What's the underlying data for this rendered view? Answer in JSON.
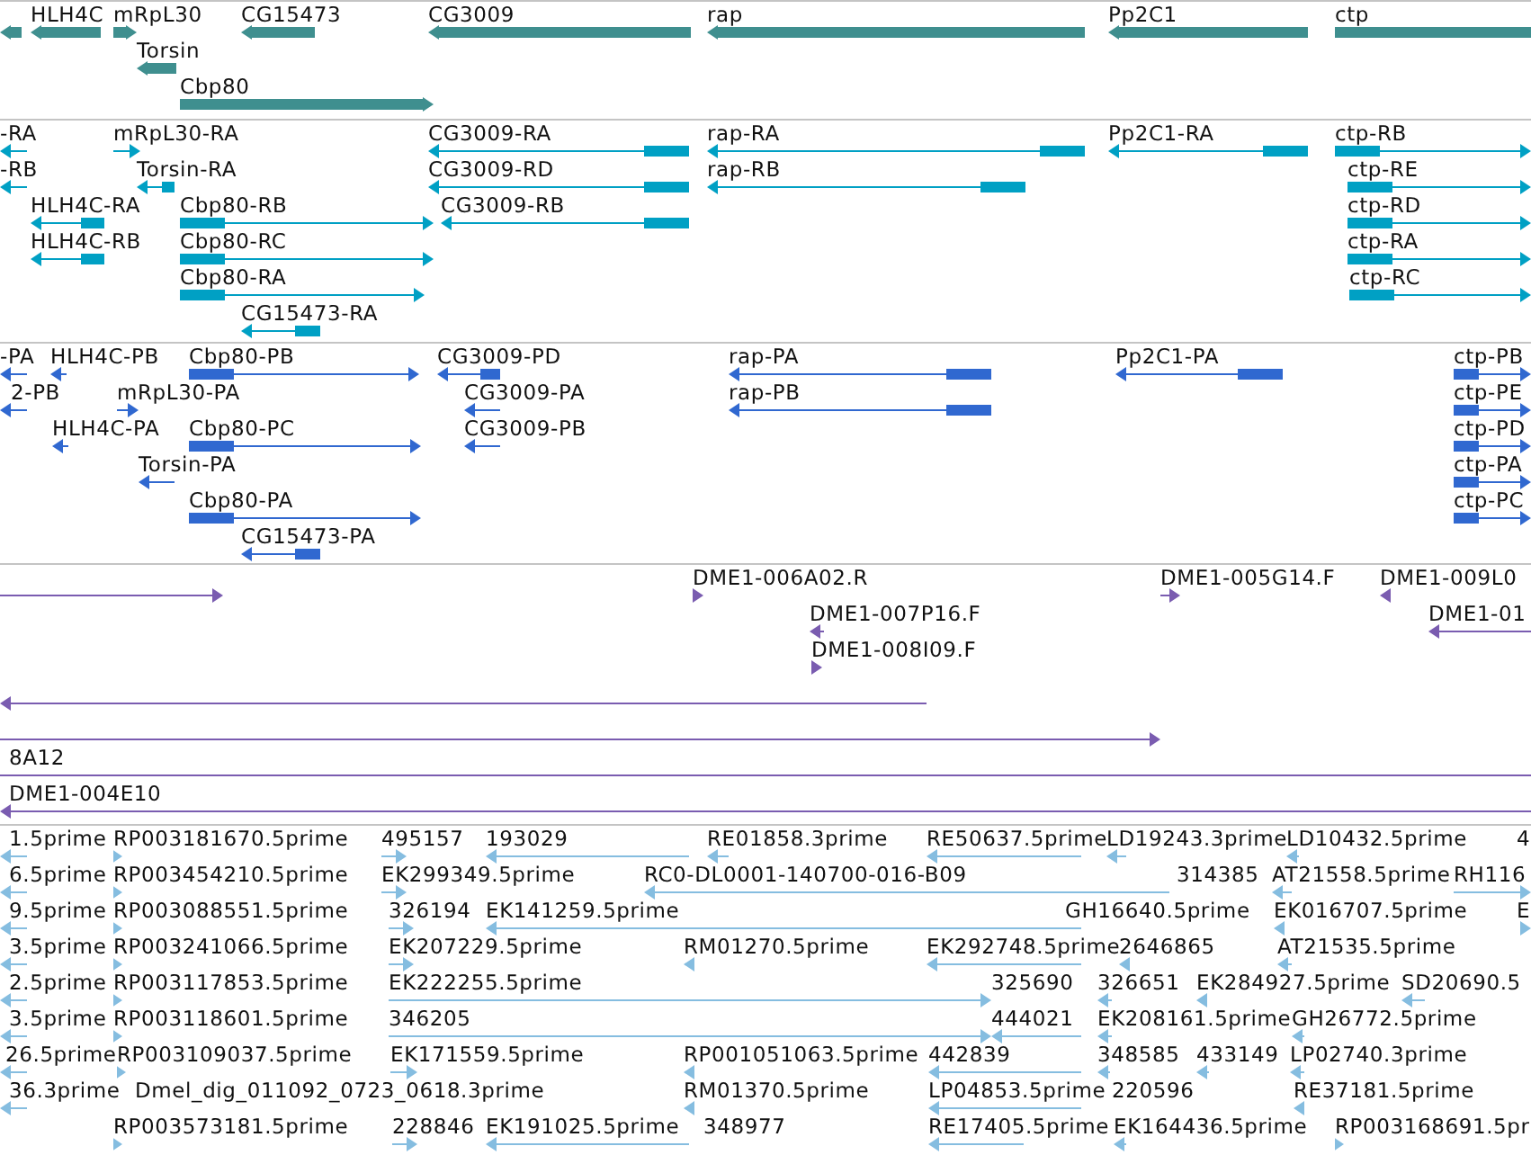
{
  "tracks": [
    {
      "kind": "gene",
      "color": "#3f8f8f",
      "rows": [
        {
          "features": [
            {
              "kind": "reverse"
            },
            {
              "label": "HLH4C",
              "kind": "reverse"
            },
            {
              "label": "mRpL30",
              "kind": "forward"
            },
            {
              "label": "CG15473",
              "kind": "reverse"
            },
            {
              "label": "CG3009",
              "kind": "reverse"
            },
            {
              "label": "rap",
              "kind": "reverse"
            },
            {
              "label": "Pp2C1",
              "kind": "reverse"
            },
            {
              "label": "ctp",
              "kind": "plain"
            }
          ]
        },
        {
          "features": [
            {
              "label": "Torsin",
              "kind": "reverse"
            }
          ]
        },
        {
          "features": [
            {
              "label": "Cbp80",
              "kind": "forward"
            }
          ]
        }
      ]
    },
    {
      "kind": "transcript",
      "color": "#00a0c4",
      "rows": [
        {
          "features": [
            {
              "label": "-RA",
              "kind": "reverse"
            },
            {
              "label": "mRpL30-RA",
              "kind": "forward"
            },
            {
              "label": "CG3009-RA",
              "kind": "reverse"
            },
            {
              "label": "rap-RA",
              "kind": "reverse"
            },
            {
              "label": "Pp2C1-RA",
              "kind": "reverse"
            },
            {
              "label": "ctp-RB",
              "kind": "forward"
            }
          ]
        },
        {
          "features": [
            {
              "label": "-RB",
              "kind": "reverse"
            },
            {
              "label": "Torsin-RA",
              "kind": "reverse"
            },
            {
              "label": "CG3009-RD",
              "kind": "reverse"
            },
            {
              "label": "rap-RB",
              "kind": "reverse"
            },
            {
              "label": "ctp-RE",
              "kind": "forward"
            }
          ]
        },
        {
          "features": [
            {
              "label": "HLH4C-RA",
              "kind": "reverse"
            },
            {
              "label": "Cbp80-RB",
              "kind": "forward"
            },
            {
              "label": "CG3009-RB",
              "kind": "reverse"
            },
            {
              "label": "ctp-RD",
              "kind": "forward"
            }
          ]
        },
        {
          "features": [
            {
              "label": "HLH4C-RB",
              "kind": "reverse"
            },
            {
              "label": "Cbp80-RC",
              "kind": "forward"
            },
            {
              "label": "ctp-RA",
              "kind": "forward"
            }
          ]
        },
        {
          "features": [
            {
              "label": "Cbp80-RA",
              "kind": "forward"
            },
            {
              "label": "ctp-RC",
              "kind": "forward"
            }
          ]
        },
        {
          "features": [
            {
              "label": "CG15473-RA",
              "kind": "reverse"
            }
          ]
        }
      ]
    },
    {
      "kind": "transcript",
      "color": "#3068d0",
      "rows": [
        {
          "features": [
            {
              "label": "-PA",
              "kind": "reverse"
            },
            {
              "label": "HLH4C-PB",
              "kind": "reverse"
            },
            {
              "label": "Cbp80-PB",
              "kind": "forward"
            },
            {
              "label": "CG3009-PD",
              "kind": "reverse"
            },
            {
              "label": "rap-PA",
              "kind": "reverse"
            },
            {
              "label": "Pp2C1-PA",
              "kind": "reverse"
            },
            {
              "label": "ctp-PB",
              "kind": "forward"
            }
          ]
        },
        {
          "features": [
            {
              "label": "2-PB",
              "kind": "reverse"
            },
            {
              "label": "mRpL30-PA",
              "kind": "forward"
            },
            {
              "label": "CG3009-PA",
              "kind": "reverse"
            },
            {
              "label": "rap-PB",
              "kind": "reverse"
            },
            {
              "label": "ctp-PE",
              "kind": "forward"
            }
          ]
        },
        {
          "features": [
            {
              "label": "HLH4C-PA",
              "kind": "reverse"
            },
            {
              "label": "Cbp80-PC",
              "kind": "forward"
            },
            {
              "label": "CG3009-PB",
              "kind": "reverse"
            },
            {
              "label": "ctp-PD",
              "kind": "forward"
            }
          ]
        },
        {
          "features": [
            {
              "label": "Torsin-PA",
              "kind": "reverse"
            },
            {
              "label": "ctp-PA",
              "kind": "forward"
            }
          ]
        },
        {
          "features": [
            {
              "label": "Cbp80-PA",
              "kind": "forward"
            },
            {
              "label": "ctp-PC",
              "kind": "forward"
            }
          ]
        },
        {
          "features": [
            {
              "label": "CG15473-PA",
              "kind": "reverse"
            }
          ]
        }
      ]
    },
    {
      "kind": "clone",
      "color": "#7a5cb0",
      "rows": [
        {
          "features": [
            {
              "kind": "forward"
            },
            {
              "label": "DME1-006A02.R",
              "kind": "forward"
            },
            {
              "label": "DME1-005G14.F",
              "kind": "forward"
            },
            {
              "label": "DME1-009L0",
              "kind": "reverse"
            }
          ]
        },
        {
          "features": [
            {
              "label": "DME1-007P16.F",
              "kind": "reverse"
            },
            {
              "label": "DME1-01",
              "kind": "reverse"
            }
          ]
        },
        {
          "features": [
            {
              "label": "DME1-008I09.F",
              "kind": "forward"
            }
          ]
        },
        {
          "features": [
            {
              "kind": "reverse"
            }
          ]
        },
        {
          "features": [
            {
              "kind": "forward"
            }
          ]
        },
        {
          "features": [
            {
              "label": "8A12",
              "kind": "plain"
            }
          ]
        },
        {
          "features": [
            {
              "label": "DME1-004E10",
              "kind": "reverse"
            }
          ]
        }
      ]
    },
    {
      "kind": "est",
      "color": "#85bde0",
      "rows": [
        {
          "features": [
            {
              "label": "1.5prime",
              "kind": "reverse"
            },
            {
              "label": "RP003181670.5prime",
              "kind": "forward"
            },
            {
              "label": "495157",
              "kind": "forward"
            },
            {
              "label": "193029",
              "kind": "reverse"
            },
            {
              "label": "RE01858.3prime",
              "kind": "reverse"
            },
            {
              "label": "RE50637.5prime",
              "kind": "reverse"
            },
            {
              "label": "LD19243.3prime",
              "kind": "reverse"
            },
            {
              "label": "LD10432.5prime",
              "kind": "reverse"
            },
            {
              "label": "4"
            }
          ]
        },
        {
          "features": [
            {
              "label": "6.5prime",
              "kind": "reverse"
            },
            {
              "label": "RP003454210.5prime",
              "kind": "forward"
            },
            {
              "label": "EK299349.5prime",
              "kind": "forward"
            },
            {
              "label": "RC0-DL0001-140700-016-B09",
              "kind": "reverse"
            },
            {
              "label": "314385"
            },
            {
              "label": "AT21558.5prime",
              "kind": "reverse"
            },
            {
              "label": "RH116",
              "kind": "forward"
            }
          ]
        },
        {
          "features": [
            {
              "label": "9.5prime",
              "kind": "reverse"
            },
            {
              "label": "RP003088551.5prime",
              "kind": "forward"
            },
            {
              "label": "326194",
              "kind": "forward"
            },
            {
              "label": "EK141259.5prime",
              "kind": "reverse"
            },
            {
              "label": "GH16640.5prime"
            },
            {
              "label": "EK016707.5prime",
              "kind": "reverse"
            },
            {
              "label": "E",
              "kind": "forward"
            }
          ]
        },
        {
          "features": [
            {
              "label": "3.5prime",
              "kind": "reverse"
            },
            {
              "label": "RP003241066.5prime",
              "kind": "forward"
            },
            {
              "label": "EK207229.5prime",
              "kind": "forward"
            },
            {
              "label": "RM01270.5prime",
              "kind": "reverse"
            },
            {
              "label": "EK292748.5prime",
              "kind": "reverse"
            },
            {
              "label": "2646865",
              "kind": "reverse"
            },
            {
              "label": "AT21535.5prime",
              "kind": "reverse"
            }
          ]
        },
        {
          "features": [
            {
              "label": "2.5prime",
              "kind": "reverse"
            },
            {
              "label": "RP003117853.5prime",
              "kind": "forward"
            },
            {
              "label": "EK222255.5prime",
              "kind": "forward"
            },
            {
              "label": "325690"
            },
            {
              "label": "326651",
              "kind": "reverse"
            },
            {
              "label": "EK284927.5prime",
              "kind": "reverse"
            },
            {
              "label": "SD20690.5",
              "kind": "reverse"
            }
          ]
        },
        {
          "features": [
            {
              "label": "3.5prime",
              "kind": "reverse"
            },
            {
              "label": "RP003118601.5prime",
              "kind": "forward"
            },
            {
              "label": "346205",
              "kind": "forward"
            },
            {
              "label": "444021",
              "kind": "reverse"
            },
            {
              "label": "EK208161.5prime",
              "kind": "reverse"
            },
            {
              "label": "GH26772.5prime",
              "kind": "reverse"
            }
          ]
        },
        {
          "features": [
            {
              "label": "26.5prime",
              "kind": "reverse"
            },
            {
              "label": "RP003109037.5prime",
              "kind": "forward"
            },
            {
              "label": "EK171559.5prime",
              "kind": "forward"
            },
            {
              "label": "RP001051063.5prime",
              "kind": "reverse"
            },
            {
              "label": "442839",
              "kind": "reverse"
            },
            {
              "label": "348585",
              "kind": "reverse"
            },
            {
              "label": "433149",
              "kind": "reverse"
            },
            {
              "label": "LP02740.3prime",
              "kind": "reverse"
            }
          ]
        },
        {
          "features": [
            {
              "label": "36.3prime",
              "kind": "reverse"
            },
            {
              "label": "Dmel_dig_011092_0723_0618.3prime"
            },
            {
              "label": "RM01370.5prime",
              "kind": "reverse"
            },
            {
              "label": "LP04853.5prime",
              "kind": "reverse"
            },
            {
              "label": "220596"
            },
            {
              "label": "RE37181.5prime",
              "kind": "reverse"
            }
          ]
        },
        {
          "features": [
            {
              "label": "RP003573181.5prime",
              "kind": "forward"
            },
            {
              "label": "228846",
              "kind": "forward"
            },
            {
              "label": "EK191025.5prime",
              "kind": "reverse"
            },
            {
              "label": "348977"
            },
            {
              "label": "RE17405.5prime",
              "kind": "reverse"
            },
            {
              "label": "EK164436.5prime",
              "kind": "reverse"
            },
            {
              "label": "RP003168691.5pr",
              "kind": "forward"
            }
          ]
        }
      ]
    }
  ]
}
